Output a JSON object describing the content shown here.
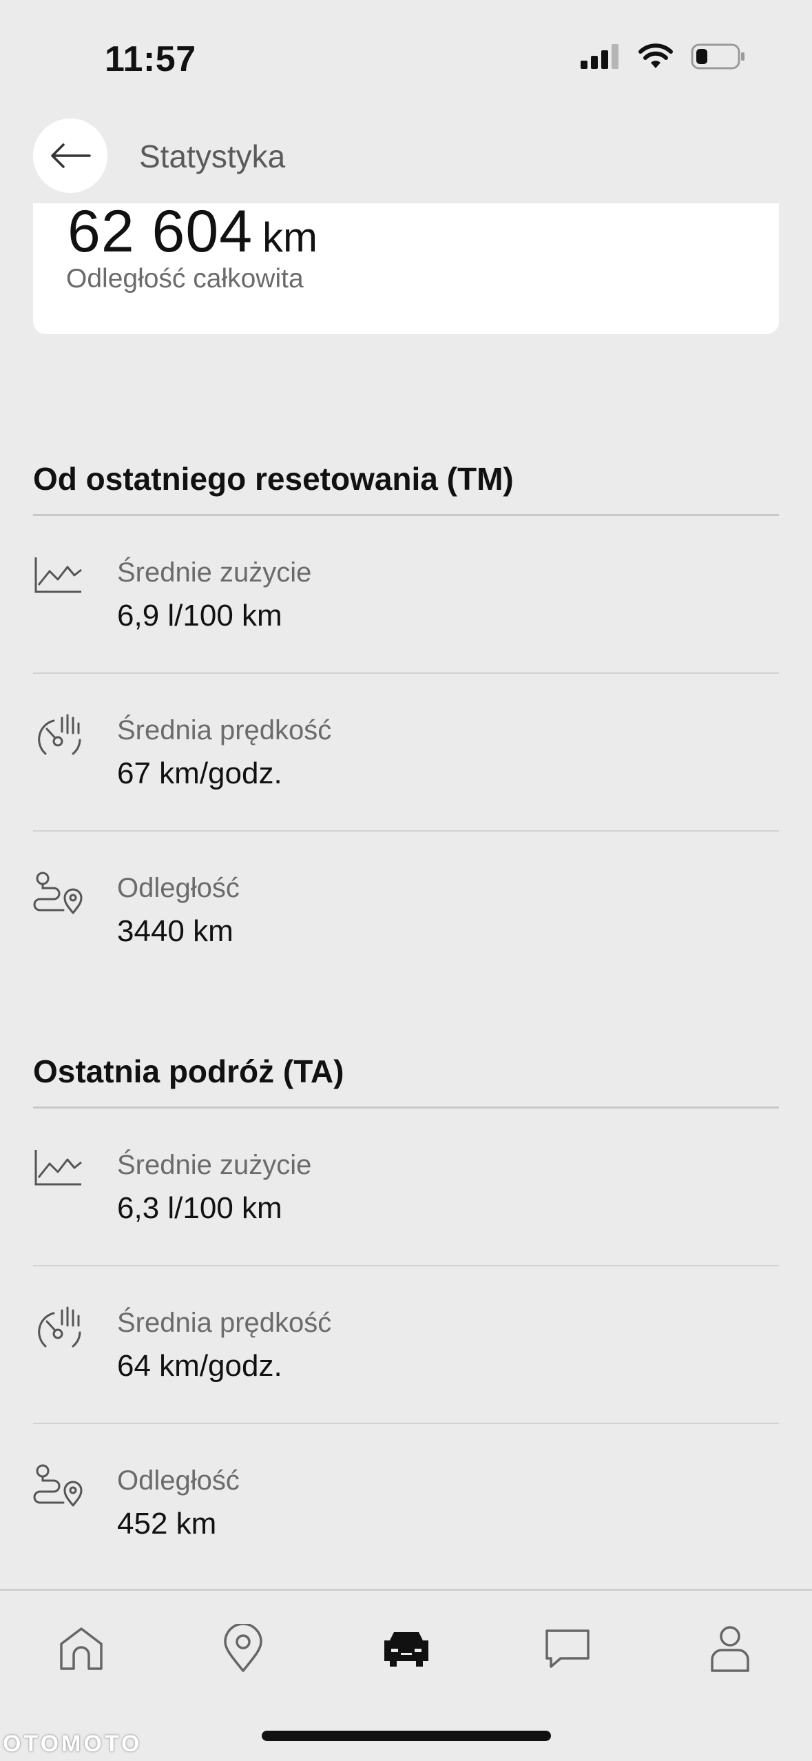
{
  "status_bar": {
    "time": "11:57"
  },
  "header": {
    "title": "Statystyka"
  },
  "odometer": {
    "value": "62 604",
    "unit": "km",
    "label": "Odległość całkowita"
  },
  "sections": [
    {
      "title": "Od ostatniego resetowania (TM)",
      "rows": [
        {
          "icon": "chart-icon",
          "label": "Średnie zużycie",
          "value": "6,9 l/100 km"
        },
        {
          "icon": "speedometer-icon",
          "label": "Średnia prędkość",
          "value": "67 km/godz."
        },
        {
          "icon": "route-icon",
          "label": "Odległość",
          "value": "3440 km"
        }
      ]
    },
    {
      "title": "Ostatnia podróż (TA)",
      "rows": [
        {
          "icon": "chart-icon",
          "label": "Średnie zużycie",
          "value": "6,3 l/100 km"
        },
        {
          "icon": "speedometer-icon",
          "label": "Średnia prędkość",
          "value": "64 km/godz."
        },
        {
          "icon": "route-icon",
          "label": "Odległość",
          "value": "452 km"
        }
      ]
    }
  ],
  "bottom_nav": {
    "items": [
      {
        "icon": "home-icon",
        "active": false
      },
      {
        "icon": "location-icon",
        "active": false
      },
      {
        "icon": "car-icon",
        "active": true
      },
      {
        "icon": "chat-icon",
        "active": false
      },
      {
        "icon": "profile-icon",
        "active": false
      }
    ]
  },
  "watermark": "OTOMOTO",
  "colors": {
    "background": "#ebebeb",
    "card": "#ffffff",
    "text_primary": "#111111",
    "text_secondary": "#6b6b6b"
  }
}
